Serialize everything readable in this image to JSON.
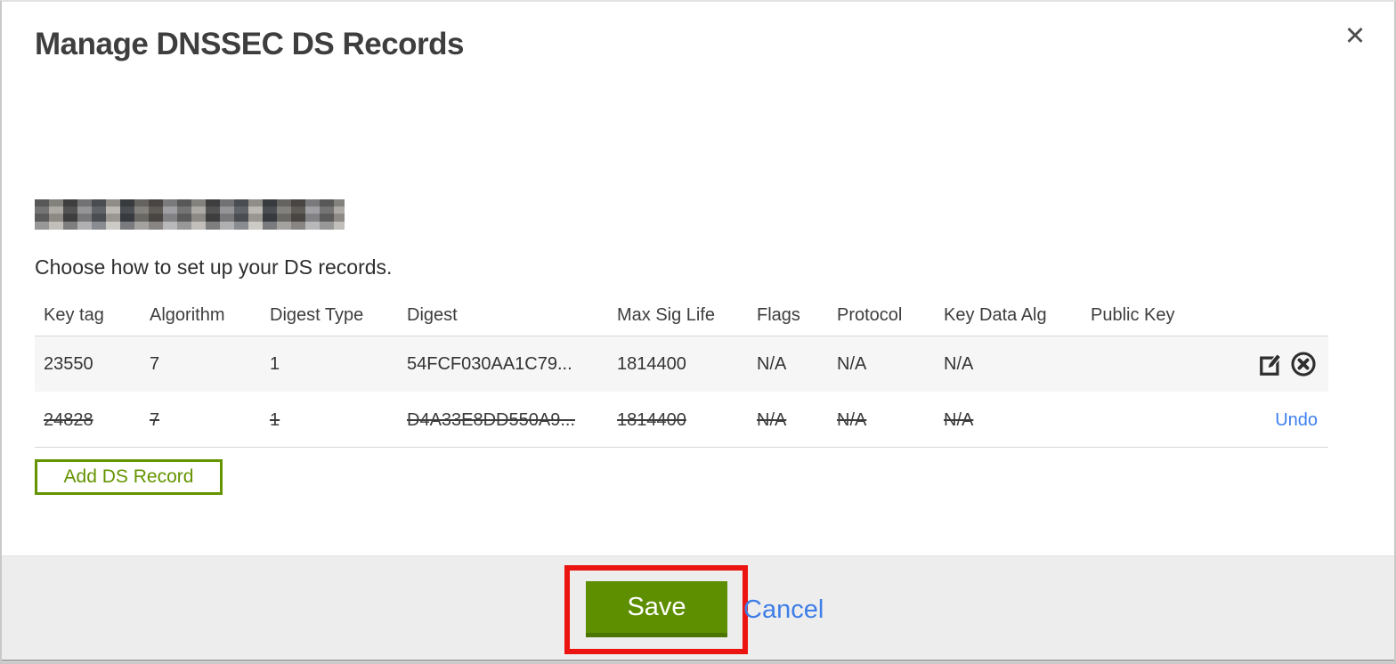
{
  "modal": {
    "title": "Manage DNSSEC DS Records",
    "subtitle": "Choose how to set up your DS records.",
    "close_glyph": "✕"
  },
  "table": {
    "headers": [
      "Key tag",
      "Algorithm",
      "Digest Type",
      "Digest",
      "Max Sig Life",
      "Flags",
      "Protocol",
      "Key Data Alg",
      "Public Key"
    ],
    "rows": [
      {
        "key_tag": "23550",
        "algorithm": "7",
        "digest_type": "1",
        "digest": "54FCF030AA1C79...",
        "max_sig_life": "1814400",
        "flags": "N/A",
        "protocol": "N/A",
        "key_data_alg": "N/A",
        "public_key": "",
        "state": "active"
      },
      {
        "key_tag": "24828",
        "algorithm": "7",
        "digest_type": "1",
        "digest": "D4A33E8DD550A9...",
        "max_sig_life": "1814400",
        "flags": "N/A",
        "protocol": "N/A",
        "key_data_alg": "N/A",
        "public_key": "",
        "state": "marked-for-deletion",
        "undo_label": "Undo"
      }
    ]
  },
  "buttons": {
    "add_ds_record": "Add DS Record",
    "save": "Save",
    "cancel": "Cancel"
  },
  "icons": {
    "edit": "edit-icon",
    "delete": "delete-icon",
    "close": "close-icon"
  },
  "colors": {
    "green_button_bg": "#5e8f00",
    "green_button_border": "#4c7500",
    "green_outline": "#649400",
    "link_blue": "#3e7ee8",
    "annotation_red": "#ec1410",
    "row_highlight_bg": "#f6f6f6",
    "footer_bg": "#ededed",
    "text_dark": "#333333"
  }
}
